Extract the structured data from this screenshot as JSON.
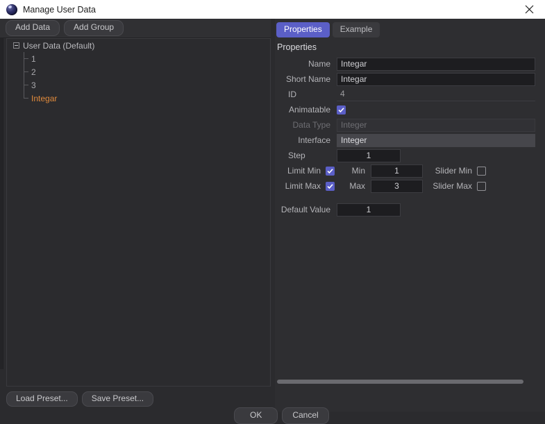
{
  "window": {
    "title": "Manage User Data",
    "icon": "app-sphere-icon",
    "close_icon": "close-icon"
  },
  "left_panel": {
    "toolbar": {
      "add_data_label": "Add Data",
      "add_group_label": "Add Group"
    },
    "tree": {
      "root": {
        "label": "User Data (Default)",
        "expanded": true,
        "expander_icon": "minus-box-icon"
      },
      "children": [
        {
          "label": "1",
          "selected": false
        },
        {
          "label": "2",
          "selected": false
        },
        {
          "label": "3",
          "selected": false
        },
        {
          "label": "Integar",
          "selected": true
        }
      ]
    },
    "presets": {
      "load_label": "Load Preset...",
      "save_label": "Save Preset..."
    }
  },
  "right_panel": {
    "tabs": [
      {
        "label": "Properties",
        "active": true
      },
      {
        "label": "Example",
        "active": false
      }
    ],
    "section_title": "Properties",
    "fields": {
      "name": {
        "label": "Name",
        "value": "Integar"
      },
      "short_name": {
        "label": "Short Name",
        "value": "Integar"
      },
      "id": {
        "label": "ID",
        "value": "4"
      },
      "animatable": {
        "label": "Animatable",
        "checked": true
      },
      "data_type": {
        "label": "Data Type",
        "value": "Integer",
        "disabled": true
      },
      "interface": {
        "label": "Interface",
        "value": "Integer"
      },
      "step": {
        "label": "Step",
        "value": "1"
      },
      "limit_min": {
        "label": "Limit Min",
        "checked": true
      },
      "min": {
        "label": "Min",
        "value": "1"
      },
      "slider_min": {
        "label": "Slider Min",
        "checked": false
      },
      "limit_max": {
        "label": "Limit Max",
        "checked": true
      },
      "max": {
        "label": "Max",
        "value": "3"
      },
      "slider_max": {
        "label": "Slider Max",
        "checked": false
      },
      "default_value": {
        "label": "Default Value",
        "value": "1"
      }
    },
    "scrollbar": {
      "name": "horizontal-scrollbar"
    }
  },
  "footer": {
    "ok_label": "OK",
    "cancel_label": "Cancel"
  },
  "colors": {
    "accent": "#5b5fc7",
    "selected_tree_item": "#e08a3c",
    "window_bg": "#2b2b2e",
    "panel_bg": "#2e2e31",
    "field_bg": "#1d1d20"
  }
}
